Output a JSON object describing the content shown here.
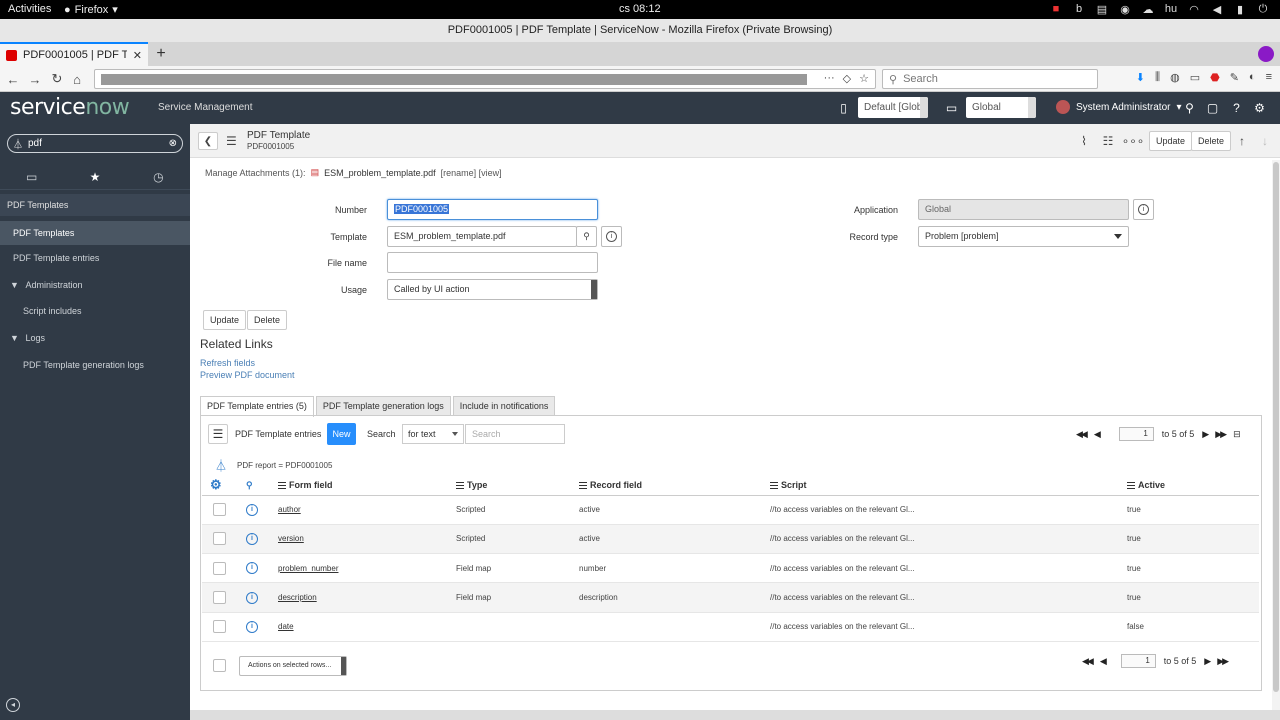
{
  "system": {
    "activities": "Activities",
    "app": "Firefox",
    "clock": "cs 08:12",
    "keyboard": "hu"
  },
  "browser": {
    "window_title": "PDF0001005 | PDF Template | ServiceNow - Mozilla Firefox (Private Browsing)",
    "tab_title": "PDF0001005 | PDF Temp",
    "search_placeholder": "Search"
  },
  "sn_header": {
    "logo_service": "service",
    "logo_now": "now",
    "subtitle": "Service Management",
    "update_set": "Default [Glob",
    "scope": "Global",
    "user": "System Administrator"
  },
  "left_nav": {
    "filter_value": "pdf",
    "group": "PDF Templates",
    "items": [
      {
        "label": "PDF Templates"
      },
      {
        "label": "PDF Template entries"
      },
      {
        "label": "Administration"
      },
      {
        "label": "Script includes"
      },
      {
        "label": "Logs"
      },
      {
        "label": "PDF Template generation logs"
      }
    ]
  },
  "form_header": {
    "title": "PDF Template",
    "subtitle": "PDF0001005",
    "update": "Update",
    "delete": "Delete"
  },
  "attachments": {
    "label": "Manage Attachments (1):",
    "file": "ESM_problem_template.pdf",
    "actions": "[rename] [view]"
  },
  "form": {
    "number_label": "Number",
    "number_value": "PDF0001005",
    "template_label": "Template",
    "template_value": "ESM_problem_template.pdf",
    "filename_label": "File name",
    "filename_value": "",
    "usage_label": "Usage",
    "usage_value": "Called by UI action",
    "application_label": "Application",
    "application_value": "Global",
    "record_type_label": "Record type",
    "record_type_value": "Problem [problem]",
    "update_btn": "Update",
    "delete_btn": "Delete"
  },
  "related_links": {
    "title": "Related Links",
    "links": [
      "Refresh fields",
      "Preview PDF document"
    ]
  },
  "related_tabs": [
    "PDF Template entries (5)",
    "PDF Template generation logs",
    "Include in notifications"
  ],
  "list": {
    "name": "PDF Template entries",
    "new_btn": "New",
    "search_label": "Search",
    "search_field": "for text",
    "search_placeholder": "Search",
    "page": "1",
    "range": "to 5 of 5",
    "breadcrumb": "PDF report = PDF0001005",
    "columns": [
      "Form field",
      "Type",
      "Record field",
      "Script",
      "Active"
    ],
    "rows": [
      {
        "form_field": "author",
        "type": "Scripted",
        "record_field": "active",
        "script": "//to access variables on the relevant Gl...",
        "active": "true"
      },
      {
        "form_field": "version",
        "type": "Scripted",
        "record_field": "active",
        "script": "//to access variables on the relevant Gl...",
        "active": "true"
      },
      {
        "form_field": "problem_number",
        "type": "Field map",
        "record_field": "number",
        "script": "//to access variables on the relevant Gl...",
        "active": "true"
      },
      {
        "form_field": "description",
        "type": "Field map",
        "record_field": "description",
        "script": "//to access variables on the relevant Gl...",
        "active": "true"
      },
      {
        "form_field": "date",
        "type": "",
        "record_field": "",
        "script": "//to access variables on the relevant Gl...",
        "active": "false"
      }
    ],
    "actions_placeholder": "Actions on selected rows..."
  },
  "colors": {
    "sn_header": "#303a46",
    "accent_blue": "#278efc",
    "focus_blue": "#4a90d9"
  }
}
